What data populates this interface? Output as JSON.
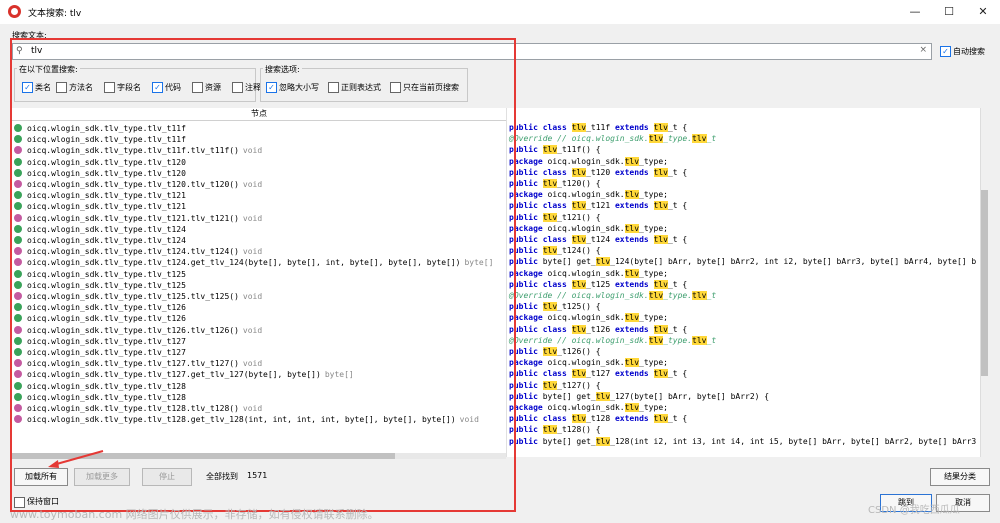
{
  "window": {
    "title": "文本搜索: tlv",
    "controls": [
      "—",
      "☐",
      "✕"
    ]
  },
  "search": {
    "label": "搜索文本:",
    "value": "tlv",
    "clear": "×",
    "auto_search_label": "自动搜索",
    "auto_search_checked": true
  },
  "scope": {
    "title": "在以下位置搜索:",
    "options": [
      {
        "label": "类名",
        "checked": true
      },
      {
        "label": "方法名",
        "checked": false
      },
      {
        "label": "字段名",
        "checked": false
      },
      {
        "label": "代码",
        "checked": true
      },
      {
        "label": "资源",
        "checked": false
      },
      {
        "label": "注释",
        "checked": false
      }
    ]
  },
  "search_options": {
    "title": "搜索选项:",
    "options": [
      {
        "label": "忽略大小写",
        "checked": true
      },
      {
        "label": "正则表达式",
        "checked": false
      },
      {
        "label": "只在当前页搜索",
        "checked": false
      }
    ]
  },
  "results": {
    "column_header": "节点",
    "rows": [
      {
        "icon": "class",
        "text": "oicq.wlogin_sdk.tlv_type.tlv_t11f",
        "ret": ""
      },
      {
        "icon": "class",
        "text": "oicq.wlogin_sdk.tlv_type.tlv_t11f",
        "ret": ""
      },
      {
        "icon": "method",
        "text": "oicq.wlogin_sdk.tlv_type.tlv_t11f.tlv_t11f()",
        "ret": "void"
      },
      {
        "icon": "class",
        "text": "oicq.wlogin_sdk.tlv_type.tlv_t120",
        "ret": ""
      },
      {
        "icon": "class",
        "text": "oicq.wlogin_sdk.tlv_type.tlv_t120",
        "ret": ""
      },
      {
        "icon": "method",
        "text": "oicq.wlogin_sdk.tlv_type.tlv_t120.tlv_t120()",
        "ret": "void"
      },
      {
        "icon": "class",
        "text": "oicq.wlogin_sdk.tlv_type.tlv_t121",
        "ret": ""
      },
      {
        "icon": "class",
        "text": "oicq.wlogin_sdk.tlv_type.tlv_t121",
        "ret": ""
      },
      {
        "icon": "method",
        "text": "oicq.wlogin_sdk.tlv_type.tlv_t121.tlv_t121()",
        "ret": "void"
      },
      {
        "icon": "class",
        "text": "oicq.wlogin_sdk.tlv_type.tlv_t124",
        "ret": ""
      },
      {
        "icon": "class",
        "text": "oicq.wlogin_sdk.tlv_type.tlv_t124",
        "ret": ""
      },
      {
        "icon": "method",
        "text": "oicq.wlogin_sdk.tlv_type.tlv_t124.tlv_t124()",
        "ret": "void"
      },
      {
        "icon": "method",
        "text": "oicq.wlogin_sdk.tlv_type.tlv_t124.get_tlv_124(byte[], byte[], int, byte[], byte[], byte[])",
        "ret": "byte[]"
      },
      {
        "icon": "class",
        "text": "oicq.wlogin_sdk.tlv_type.tlv_t125",
        "ret": ""
      },
      {
        "icon": "class",
        "text": "oicq.wlogin_sdk.tlv_type.tlv_t125",
        "ret": ""
      },
      {
        "icon": "method",
        "text": "oicq.wlogin_sdk.tlv_type.tlv_t125.tlv_t125()",
        "ret": "void"
      },
      {
        "icon": "class",
        "text": "oicq.wlogin_sdk.tlv_type.tlv_t126",
        "ret": ""
      },
      {
        "icon": "class",
        "text": "oicq.wlogin_sdk.tlv_type.tlv_t126",
        "ret": ""
      },
      {
        "icon": "method",
        "text": "oicq.wlogin_sdk.tlv_type.tlv_t126.tlv_t126()",
        "ret": "void"
      },
      {
        "icon": "class",
        "text": "oicq.wlogin_sdk.tlv_type.tlv_t127",
        "ret": ""
      },
      {
        "icon": "class",
        "text": "oicq.wlogin_sdk.tlv_type.tlv_t127",
        "ret": ""
      },
      {
        "icon": "method",
        "text": "oicq.wlogin_sdk.tlv_type.tlv_t127.tlv_t127()",
        "ret": "void"
      },
      {
        "icon": "method",
        "text": "oicq.wlogin_sdk.tlv_type.tlv_t127.get_tlv_127(byte[], byte[])",
        "ret": "byte[]"
      },
      {
        "icon": "class",
        "text": "oicq.wlogin_sdk.tlv_type.tlv_t128",
        "ret": ""
      },
      {
        "icon": "class",
        "text": "oicq.wlogin_sdk.tlv_type.tlv_t128",
        "ret": ""
      },
      {
        "icon": "method",
        "text": "oicq.wlogin_sdk.tlv_type.tlv_t128.tlv_t128()",
        "ret": "void"
      },
      {
        "icon": "method",
        "text": "oicq.wlogin_sdk.tlv_type.tlv_t128.get_tlv_128(int, int, int, int, byte[], byte[], byte[])",
        "ret": "void"
      }
    ],
    "code": [
      [
        [
          "kw",
          "public class "
        ],
        [
          "hl",
          "tlv"
        ],
        [
          "",
          "_t11f "
        ],
        [
          "kw",
          "extends "
        ],
        [
          "hl",
          "tlv"
        ],
        [
          "",
          "_t {"
        ]
      ],
      [
        [
          "cm",
          "@Override // oicq.wlogin_sdk."
        ],
        [
          "hl",
          "tlv"
        ],
        [
          "cm",
          "_type."
        ],
        [
          "hl",
          "tlv"
        ],
        [
          "cm",
          "_t"
        ]
      ],
      [
        [
          "kw",
          "public "
        ],
        [
          "hl",
          "tlv"
        ],
        [
          "",
          "_t11f() {"
        ]
      ],
      [
        [
          "kw",
          "package "
        ],
        [
          "",
          "oicq.wlogin_sdk."
        ],
        [
          "hl",
          "tlv"
        ],
        [
          "",
          "_type;"
        ]
      ],
      [
        [
          "kw",
          "public class "
        ],
        [
          "hl",
          "tlv"
        ],
        [
          "",
          "_t120 "
        ],
        [
          "kw",
          "extends "
        ],
        [
          "hl",
          "tlv"
        ],
        [
          "",
          "_t {"
        ]
      ],
      [
        [
          "kw",
          "public "
        ],
        [
          "hl",
          "tlv"
        ],
        [
          "",
          "_t120() {"
        ]
      ],
      [
        [
          "kw",
          "package "
        ],
        [
          "",
          "oicq.wlogin_sdk."
        ],
        [
          "hl",
          "tlv"
        ],
        [
          "",
          "_type;"
        ]
      ],
      [
        [
          "kw",
          "public class "
        ],
        [
          "hl",
          "tlv"
        ],
        [
          "",
          "_t121 "
        ],
        [
          "kw",
          "extends "
        ],
        [
          "hl",
          "tlv"
        ],
        [
          "",
          "_t {"
        ]
      ],
      [
        [
          "kw",
          "public "
        ],
        [
          "hl",
          "tlv"
        ],
        [
          "",
          "_t121() {"
        ]
      ],
      [
        [
          "kw",
          "package "
        ],
        [
          "",
          "oicq.wlogin_sdk."
        ],
        [
          "hl",
          "tlv"
        ],
        [
          "",
          "_type;"
        ]
      ],
      [
        [
          "kw",
          "public class "
        ],
        [
          "hl",
          "tlv"
        ],
        [
          "",
          "_t124 "
        ],
        [
          "kw",
          "extends "
        ],
        [
          "hl",
          "tlv"
        ],
        [
          "",
          "_t {"
        ]
      ],
      [
        [
          "kw",
          "public "
        ],
        [
          "hl",
          "tlv"
        ],
        [
          "",
          "_t124() {"
        ]
      ],
      [
        [
          "kw",
          "public "
        ],
        [
          "",
          "byte[] get_"
        ],
        [
          "hl",
          "tlv"
        ],
        [
          "",
          "_124(byte[] bArr, byte[] bArr2, int i2, byte[] bArr3, byte[] bArr4, byte[] b"
        ]
      ],
      [
        [
          "kw",
          "package "
        ],
        [
          "",
          "oicq.wlogin_sdk."
        ],
        [
          "hl",
          "tlv"
        ],
        [
          "",
          "_type;"
        ]
      ],
      [
        [
          "kw",
          "public class "
        ],
        [
          "hl",
          "tlv"
        ],
        [
          "",
          "_t125 "
        ],
        [
          "kw",
          "extends "
        ],
        [
          "hl",
          "tlv"
        ],
        [
          "",
          "_t {"
        ]
      ],
      [
        [
          "cm",
          "@Override // oicq.wlogin_sdk."
        ],
        [
          "hl",
          "tlv"
        ],
        [
          "cm",
          "_type."
        ],
        [
          "hl",
          "tlv"
        ],
        [
          "cm",
          "_t"
        ]
      ],
      [
        [
          "kw",
          "public "
        ],
        [
          "hl",
          "tlv"
        ],
        [
          "",
          "_t125() {"
        ]
      ],
      [
        [
          "kw",
          "package "
        ],
        [
          "",
          "oicq.wlogin_sdk."
        ],
        [
          "hl",
          "tlv"
        ],
        [
          "",
          "_type;"
        ]
      ],
      [
        [
          "kw",
          "public class "
        ],
        [
          "hl",
          "tlv"
        ],
        [
          "",
          "_t126 "
        ],
        [
          "kw",
          "extends "
        ],
        [
          "hl",
          "tlv"
        ],
        [
          "",
          "_t {"
        ]
      ],
      [
        [
          "cm",
          "@Override // oicq.wlogin_sdk."
        ],
        [
          "hl",
          "tlv"
        ],
        [
          "cm",
          "_type."
        ],
        [
          "hl",
          "tlv"
        ],
        [
          "cm",
          "_t"
        ]
      ],
      [
        [
          "kw",
          "public "
        ],
        [
          "hl",
          "tlv"
        ],
        [
          "",
          "_t126() {"
        ]
      ],
      [
        [
          "kw",
          "package "
        ],
        [
          "",
          "oicq.wlogin_sdk."
        ],
        [
          "hl",
          "tlv"
        ],
        [
          "",
          "_type;"
        ]
      ],
      [
        [
          "kw",
          "public class "
        ],
        [
          "hl",
          "tlv"
        ],
        [
          "",
          "_t127 "
        ],
        [
          "kw",
          "extends "
        ],
        [
          "hl",
          "tlv"
        ],
        [
          "",
          "_t {"
        ]
      ],
      [
        [
          "kw",
          "public "
        ],
        [
          "hl",
          "tlv"
        ],
        [
          "",
          "_t127() {"
        ]
      ],
      [
        [
          "kw",
          "public "
        ],
        [
          "",
          "byte[] get_"
        ],
        [
          "hl",
          "tlv"
        ],
        [
          "",
          "_127(byte[] bArr, byte[] bArr2) {"
        ]
      ],
      [
        [
          "kw",
          "package "
        ],
        [
          "",
          "oicq.wlogin_sdk."
        ],
        [
          "hl",
          "tlv"
        ],
        [
          "",
          "_type;"
        ]
      ],
      [
        [
          "kw",
          "public class "
        ],
        [
          "hl",
          "tlv"
        ],
        [
          "",
          "_t128 "
        ],
        [
          "kw",
          "extends "
        ],
        [
          "hl",
          "tlv"
        ],
        [
          "",
          "_t {"
        ]
      ],
      [
        [
          "kw",
          "public "
        ],
        [
          "hl",
          "tlv"
        ],
        [
          "",
          "_t128() {"
        ]
      ],
      [
        [
          "kw",
          "public "
        ],
        [
          "",
          "byte[] get_"
        ],
        [
          "hl",
          "tlv"
        ],
        [
          "",
          "_128(int i2, int i3, int i4, int i5, byte[] bArr, byte[] bArr2, byte[] bArr3"
        ]
      ]
    ]
  },
  "footer": {
    "load_all": "加载所有",
    "load_more": "加载更多",
    "stop": "停止",
    "found_label": "全部找到",
    "found_count": "1571",
    "group_results": "结果分类",
    "keep_window": "保持窗口",
    "goto": "跳到",
    "cancel": "取消"
  },
  "watermark": {
    "left": "www.toymoban.com 网络图片仅供展示，非存储，如有侵权请联系删除。",
    "right": "CSDN @我吃西瓜瓜"
  },
  "colors": {
    "highlight": "#ffd83a",
    "annotation_red": "#e53935",
    "keyword": "#0000cc"
  }
}
